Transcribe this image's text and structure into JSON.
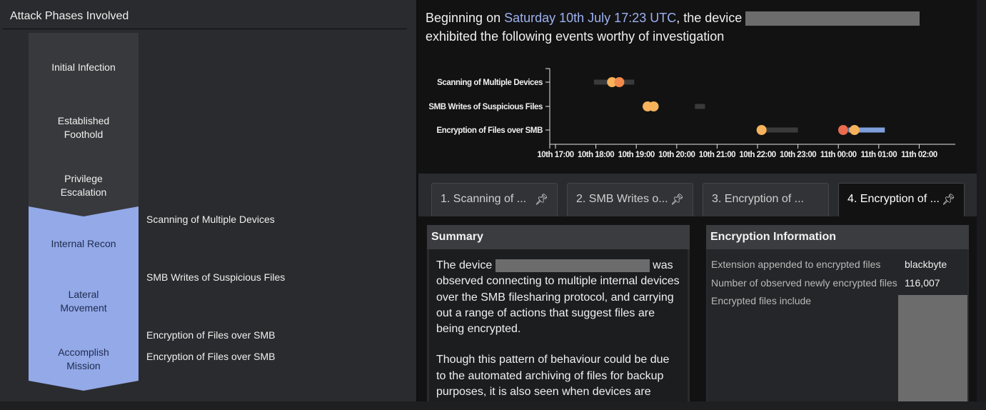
{
  "left": {
    "title": "Attack Phases Involved",
    "phases": [
      {
        "label": "Initial Infection",
        "state": "inactive"
      },
      {
        "label": "Established Foothold",
        "state": "inactive"
      },
      {
        "label": "Privilege Escalation",
        "state": "inactive"
      },
      {
        "label": "Internal Recon",
        "state": "active"
      },
      {
        "label": "Lateral Movement",
        "state": "active"
      },
      {
        "label": "Accomplish Mission",
        "state": "active"
      }
    ],
    "events": [
      "Scanning of Multiple Devices",
      "SMB Writes of Suspicious Files",
      "Encryption of Files over SMB",
      "Encryption of Files over SMB"
    ]
  },
  "headline": {
    "prefix": "Beginning on ",
    "date": "Saturday 10th July 17:23 UTC",
    "middle": ", the device ",
    "suffix": "exhibited the following events worthy of investigation"
  },
  "chart_data": {
    "type": "scatter",
    "categories": [
      "Scanning of Multiple Devices",
      "SMB Writes of Suspicious Files",
      "Encryption of Files over SMB"
    ],
    "x_ticks": [
      "10th 17:00",
      "10th 18:00",
      "10th 19:00",
      "10th 20:00",
      "10th 21:00",
      "10th 22:00",
      "10th 23:00",
      "11th 00:00",
      "11th 01:00",
      "11th 02:00"
    ],
    "xlim_hours": [
      17,
      26
    ],
    "ranges": [
      {
        "row": 0,
        "start": 17.95,
        "end": 18.95,
        "color": "#3a3a3a"
      },
      {
        "row": 1,
        "start": 20.45,
        "end": 20.7,
        "color": "#3a3a3a"
      },
      {
        "row": 2,
        "start": 22.1,
        "end": 23.0,
        "color": "#3a3a3a"
      },
      {
        "row": 2,
        "start": 24.25,
        "end": 25.15,
        "color": "#7f9fdc"
      }
    ],
    "points": [
      {
        "row": 0,
        "x": 18.4,
        "color": "#f8b25b"
      },
      {
        "row": 0,
        "x": 18.58,
        "color": "#f28a4c"
      },
      {
        "row": 1,
        "x": 19.28,
        "color": "#f8b25b"
      },
      {
        "row": 1,
        "x": 19.43,
        "color": "#f8b25b"
      },
      {
        "row": 2,
        "x": 22.1,
        "color": "#f8b25b"
      },
      {
        "row": 2,
        "x": 24.12,
        "color": "#ea6b4e"
      },
      {
        "row": 2,
        "x": 24.4,
        "color": "#f8b25b"
      }
    ]
  },
  "tabs": [
    {
      "label": "1. Scanning of ...",
      "active": false
    },
    {
      "label": "2. SMB Writes o...",
      "active": false
    },
    {
      "label": "3. Encryption of ...",
      "active": false
    },
    {
      "label": "4. Encryption of ...",
      "active": true
    }
  ],
  "summary": {
    "title": "Summary",
    "p1_before": "The device ",
    "p1_after": " was observed connecting to multiple internal devices over the SMB filesharing protocol, and carrying out a range of actions that suggest files are being encrypted.",
    "p2": "Though this pattern of behaviour could be due to the automated archiving of files for backup purposes, it is also seen when devices are"
  },
  "encryption": {
    "title": "Encryption Information",
    "rows": [
      {
        "key": "Extension appended to encrypted files",
        "value": "blackbyte"
      },
      {
        "key": "Number of observed newly encrypted files",
        "value": "116,007"
      },
      {
        "key": "Encrypted files include",
        "value": ""
      }
    ]
  },
  "icons": {
    "pin": "pin-icon"
  }
}
